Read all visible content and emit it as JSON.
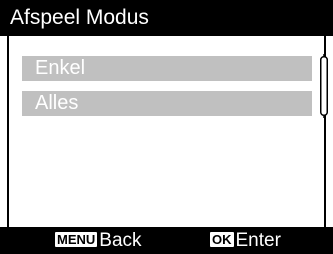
{
  "screen": {
    "title": "Afspeel Modus"
  },
  "menu": {
    "items": [
      {
        "label": "Enkel"
      },
      {
        "label": "Alles"
      }
    ]
  },
  "footer": {
    "menu_key": "MENU",
    "menu_action": "Back",
    "ok_key": "OK",
    "ok_action": "Enter"
  },
  "colors": {
    "bar_background": "#000000",
    "menu_item_background": "#c0c0c0",
    "text_light": "#ffffff"
  }
}
